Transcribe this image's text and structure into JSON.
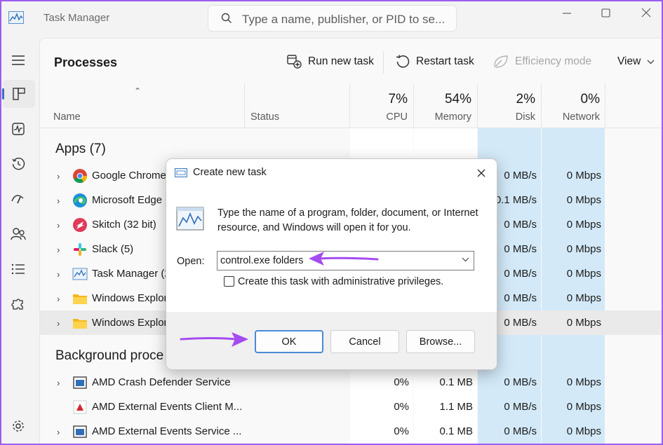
{
  "window": {
    "title": "Task Manager",
    "search_placeholder": "Type a name, publisher, or PID to se..."
  },
  "toolbar": {
    "page_title": "Processes",
    "run_new_task": "Run new task",
    "restart_task": "Restart task",
    "efficiency_mode": "Efficiency mode",
    "view": "View"
  },
  "columns": {
    "name": "Name",
    "status": "Status",
    "cpu": {
      "pct": "7%",
      "label": "CPU"
    },
    "memory": {
      "pct": "54%",
      "label": "Memory"
    },
    "disk": {
      "pct": "2%",
      "label": "Disk"
    },
    "network": {
      "pct": "0%",
      "label": "Network"
    }
  },
  "sections": {
    "apps": "Apps (7)",
    "background": "Background proce"
  },
  "apps": [
    {
      "name": "Google Chrome",
      "disk": "0 MB/s",
      "net": "0 Mbps"
    },
    {
      "name": "Microsoft Edge (",
      "disk": "0.1 MB/s",
      "net": "0 Mbps"
    },
    {
      "name": "Skitch (32 bit)",
      "disk": "0 MB/s",
      "net": "0 Mbps"
    },
    {
      "name": "Slack (5)",
      "disk": "0 MB/s",
      "net": "0 Mbps"
    },
    {
      "name": "Task Manager (2",
      "disk": "0 MB/s",
      "net": "0 Mbps"
    },
    {
      "name": "Windows Explor",
      "disk": "0 MB/s",
      "net": "0 Mbps"
    },
    {
      "name": "Windows Explor",
      "disk": "0 MB/s",
      "net": "0 Mbps"
    }
  ],
  "background": [
    {
      "name": "AMD Crash Defender Service",
      "cpu": "0%",
      "mem": "0.1 MB",
      "disk": "0 MB/s",
      "net": "0 Mbps"
    },
    {
      "name": "AMD External Events Client M...",
      "cpu": "0%",
      "mem": "1.1 MB",
      "disk": "0 MB/s",
      "net": "0 Mbps"
    },
    {
      "name": "AMD External Events Service ...",
      "cpu": "0%",
      "mem": "0.1 MB",
      "disk": "0 MB/s",
      "net": "0 Mbps"
    }
  ],
  "dialog": {
    "title": "Create new task",
    "message": "Type the name of a program, folder, document, or Internet resource, and Windows will open it for you.",
    "open_label": "Open:",
    "open_value": "control.exe folders",
    "checkbox_label": "Create this task with administrative privileges.",
    "ok": "OK",
    "cancel": "Cancel",
    "browse": "Browse..."
  },
  "colors": {
    "heat": "#d3e9f8",
    "accent": "#4a8ad6",
    "annotation_arrow": "#a54cf0"
  }
}
